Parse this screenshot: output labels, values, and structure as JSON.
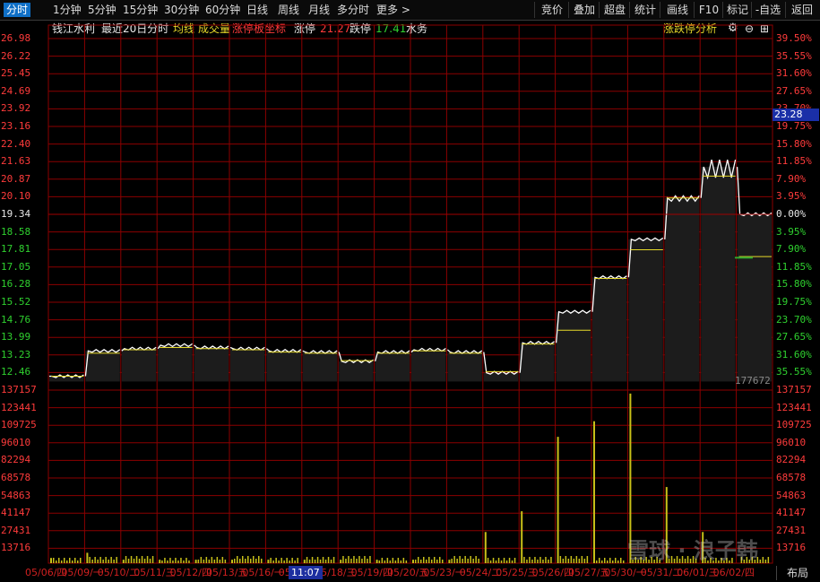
{
  "toolbar": {
    "tabs": [
      "分时",
      "1分钟",
      "5分钟",
      "15分钟",
      "30分钟",
      "60分钟",
      "日线",
      "周线",
      "月线",
      "多分时",
      "更多 >"
    ],
    "active_tab": "分时",
    "right_tools": [
      "竞价",
      "叠加",
      "超盘",
      "统计",
      "画线",
      "F10",
      "标记",
      "-自选",
      "返回"
    ]
  },
  "legend": {
    "stock_name": "钱江水利",
    "period": "最近20日分时",
    "avg_line": "均线",
    "volume": "成交量",
    "limit_axis": "涨停板坐标",
    "limit_up_label": "涨停",
    "limit_up_value": "21.27",
    "limit_down_label": "跌停",
    "limit_down_value": "17.41",
    "sector": "水务",
    "analysis_link": "涨跌停分析"
  },
  "price_axis_left": [
    "26.98",
    "26.22",
    "25.45",
    "24.69",
    "23.92",
    "23.16",
    "22.40",
    "21.63",
    "20.87",
    "20.10",
    "19.34",
    "18.58",
    "17.81",
    "17.05",
    "16.28",
    "15.52",
    "14.76",
    "13.99",
    "13.23",
    "12.46"
  ],
  "percent_axis_right": [
    "39.50%",
    "35.55%",
    "31.60%",
    "27.65%",
    "23.70%",
    "19.75%",
    "15.80%",
    "11.85%",
    "7.90%",
    "3.95%",
    "0.00%",
    "3.95%",
    "7.90%",
    "11.85%",
    "15.80%",
    "19.75%",
    "23.70%",
    "27.65%",
    "31.60%",
    "35.55%"
  ],
  "volume_axis": [
    "137157",
    "123441",
    "109725",
    "96010",
    "82294",
    "68578",
    "54863",
    "41147",
    "27431",
    "13716"
  ],
  "current_price_tag": "23.28",
  "volume_readout": "177672",
  "cursor_time": "11:07",
  "dates": [
    "05/06/四",
    "05/09/一",
    "05/10/二",
    "05/11/三",
    "05/12/四",
    "05/13/五",
    "05/16/一",
    "05/17/二",
    "05/18/三",
    "05/19/四",
    "05/20/五",
    "05/23/一",
    "05/24/二",
    "05/25/三",
    "05/26/四",
    "05/27/五",
    "05/30/一",
    "05/31/二",
    "06/01/三",
    "06/02/四"
  ],
  "layout_button": "布局",
  "watermark_text": "雪球 · 浪子韩",
  "colors": {
    "grid": "#8b0000",
    "price_line": "#ffffff",
    "avg_line": "#e6d92a",
    "volume": "#c8c018",
    "up": "#ff3b3b",
    "down": "#2fd12f"
  },
  "chart_data": {
    "type": "line",
    "title": "钱江水利 最近20日分时",
    "price_range": [
      12.46,
      26.98
    ],
    "reference_price": 19.34,
    "series": [
      {
        "name": "price",
        "x": [
          "05/06",
          "05/09",
          "05/10",
          "05/11",
          "05/12",
          "05/13",
          "05/16",
          "05/17",
          "05/18",
          "05/19",
          "05/20",
          "05/23",
          "05/24",
          "05/25",
          "05/26",
          "05/27",
          "05/30",
          "05/31",
          "06/01",
          "06/02"
        ],
        "values": [
          12.3,
          13.4,
          13.5,
          13.65,
          13.55,
          13.5,
          13.4,
          13.35,
          12.95,
          13.35,
          13.45,
          13.35,
          12.45,
          13.75,
          15.1,
          16.6,
          18.25,
          20.05,
          21.4,
          19.34
        ]
      },
      {
        "name": "均线",
        "values": [
          12.3,
          13.3,
          13.45,
          13.55,
          13.5,
          13.45,
          13.35,
          13.3,
          12.98,
          13.3,
          13.4,
          13.3,
          12.5,
          13.7,
          14.3,
          16.55,
          17.8,
          20.05,
          21.0,
          17.5
        ]
      }
    ],
    "volume_range": [
      0,
      137157
    ]
  }
}
